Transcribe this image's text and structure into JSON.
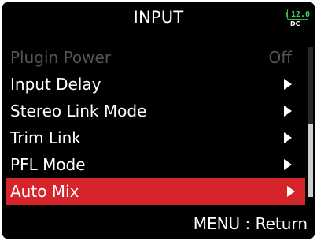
{
  "header": {
    "title": "INPUT",
    "battery": {
      "level": "12.0",
      "source": "DC",
      "color": "#39b54a"
    }
  },
  "menu": {
    "items": [
      {
        "label": "Plugin Power",
        "value": "Off",
        "state": "disabled"
      },
      {
        "label": "Input Delay",
        "icon": "chevron-right-icon"
      },
      {
        "label": "Stereo Link Mode",
        "icon": "chevron-right-icon"
      },
      {
        "label": "Trim Link",
        "icon": "chevron-right-icon"
      },
      {
        "label": "PFL Mode",
        "icon": "chevron-right-icon"
      },
      {
        "label": "Auto Mix",
        "icon": "chevron-right-icon",
        "state": "selected"
      }
    ]
  },
  "footer": {
    "hint": "MENU : Return"
  },
  "colors": {
    "selection": "#d6242b",
    "background": "#000000",
    "disabled_text": "#555555"
  }
}
